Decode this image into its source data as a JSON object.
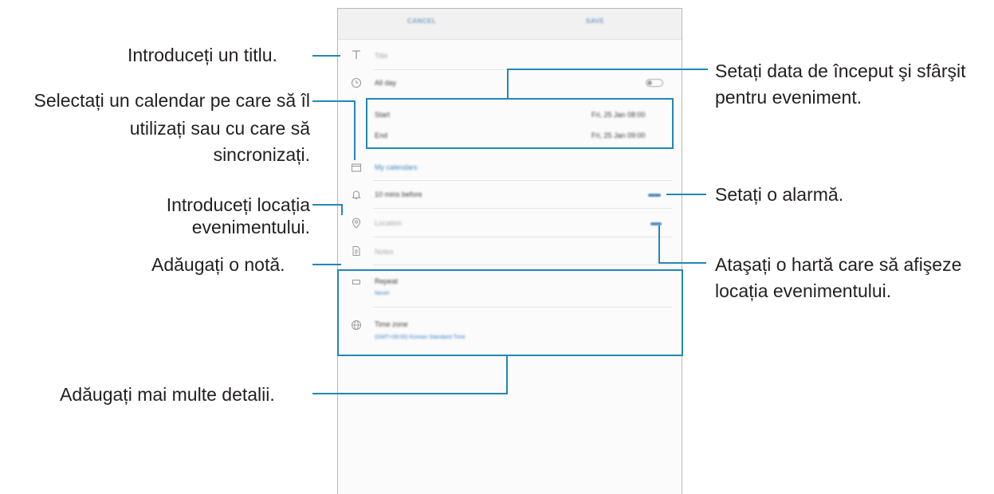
{
  "screen": {
    "header": {
      "cancel_label": "CANCEL",
      "save_label": "SAVE"
    },
    "title_placeholder": "Title",
    "all_day_label": "All day",
    "start_label": "Start",
    "start_value": "Fri, 25 Jan  08:00",
    "end_label": "End",
    "end_value": "Fri, 25 Jan  09:00",
    "calendar_label": "My calendars",
    "reminder_label": "10 mins before",
    "location_placeholder": "Location",
    "notes_placeholder": "Notes",
    "repeat_label": "Repeat",
    "repeat_value": "Never",
    "timezone_label": "Time zone",
    "timezone_value": "(GMT+09:00) Korean Standard Time"
  },
  "callouts": {
    "title": "Introduceți un titlu.",
    "calendar_line1": "Selectați un calendar pe care să îl",
    "calendar_line2": "utilizați sau cu care să",
    "calendar_line3": "sincronizați.",
    "location_line1": "Introduceți locația",
    "location_line2": "evenimentului.",
    "note": "Adăugați o notă.",
    "details": "Adăugați mai multe detalii.",
    "dates_line1": "Setați data de început şi sfârşit",
    "dates_line2": "pentru eveniment.",
    "alarm": "Setați o alarmă.",
    "map_line1": "Ataşați o hartă care să afişeze",
    "map_line2": "locația evenimentului."
  },
  "icons": [
    "title-icon",
    "clock-icon",
    "calendar-icon",
    "bell-icon",
    "location-pin-icon",
    "notes-icon",
    "repeat-icon",
    "globe-icon"
  ],
  "colors": {
    "accent": "#2387b5",
    "link_blue": "#3f87c7"
  }
}
